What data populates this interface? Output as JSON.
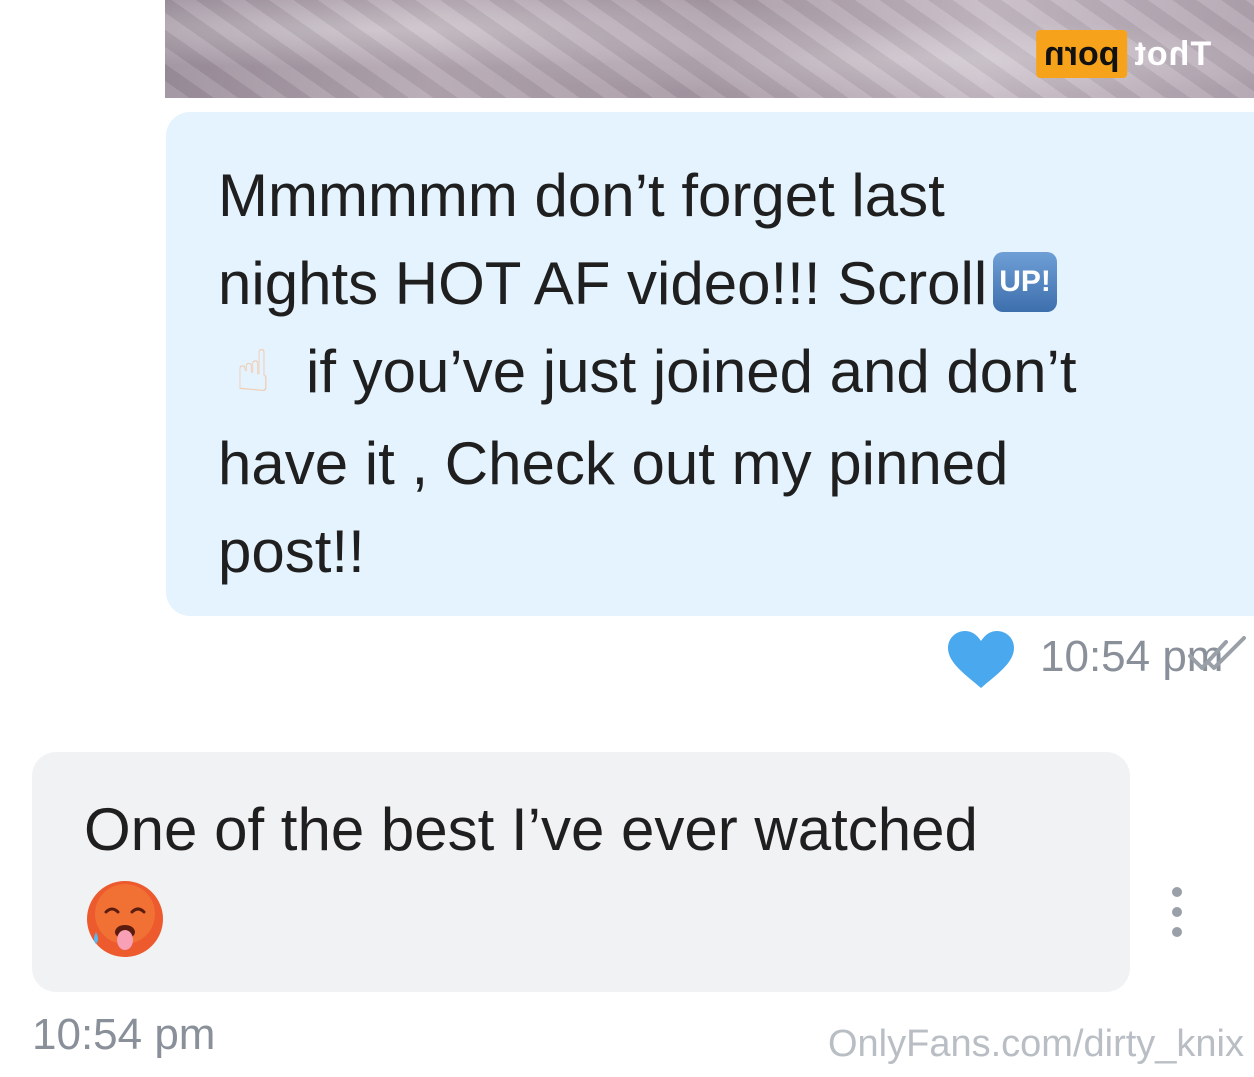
{
  "photo": {
    "watermark_plain": "Thot",
    "watermark_box": "porn"
  },
  "outgoing_message": {
    "line1": "Mmmmmm don’t forget last",
    "line2_a": "nights HOT AF video!!! Scroll",
    "up_emoji_text": "UP!",
    "finger_emoji": "☝",
    "line3": "if you’ve just joined and don’t",
    "line4": "have it , Check out my pinned",
    "line5": "post!!",
    "time": "10:54 pm",
    "liked": true,
    "read": true
  },
  "incoming_message": {
    "text": "One of the best I’ve ever watched",
    "emoji": "hot-face",
    "time": "10:54 pm"
  },
  "footer": {
    "site": "OnlyFans.com/dirty_knix"
  },
  "colors": {
    "outgoing_bubble": "#e4f3fd",
    "incoming_bubble": "#f1f2f4",
    "heart": "#4aa8ee",
    "meta_text": "#8a9099",
    "watermark_badge": "#f7a21b"
  },
  "icons": [
    "heart-icon",
    "double-check-icon",
    "more-vertical-icon",
    "hot-face-icon",
    "up-button-icon",
    "pointing-up-icon"
  ]
}
